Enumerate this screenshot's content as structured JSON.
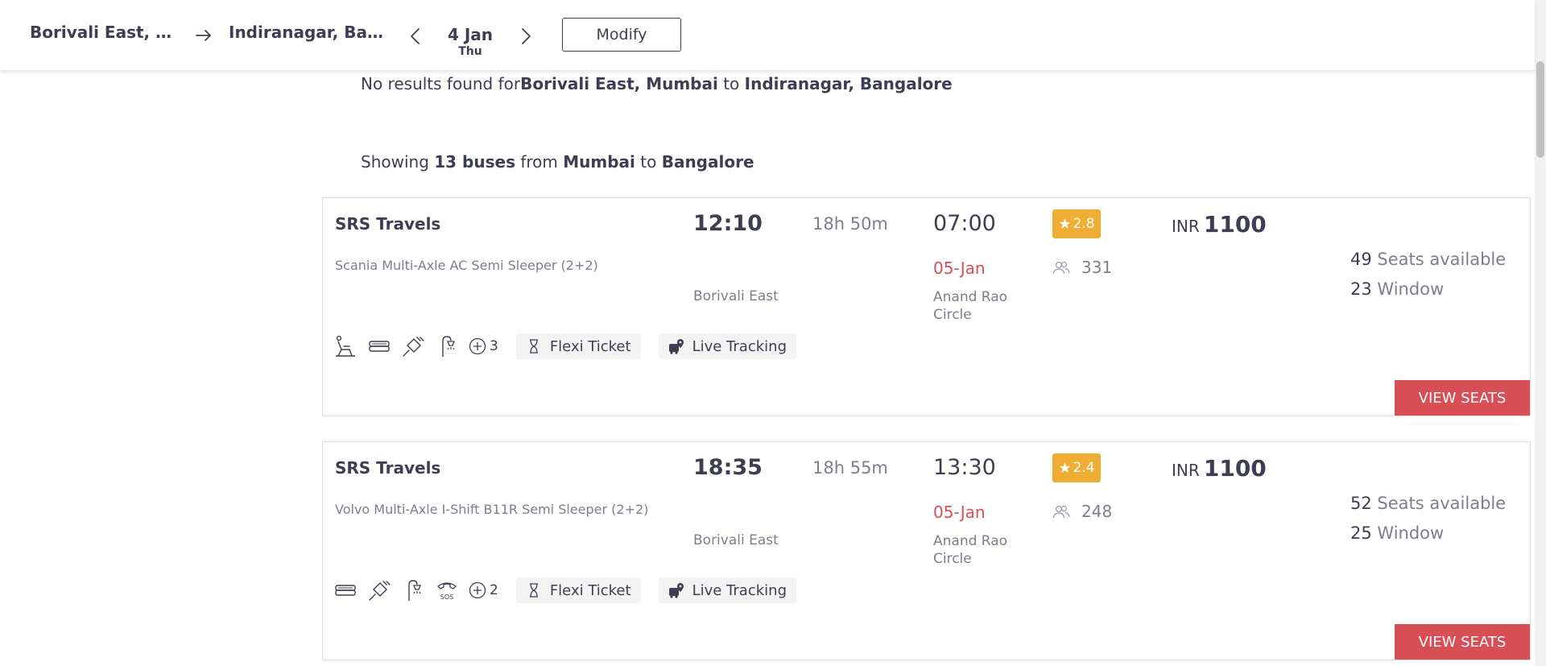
{
  "header": {
    "from": "Borivali East, M...",
    "to": "Indiranagar, Ban...",
    "date": "4 Jan",
    "day": "Thu",
    "modify_label": "Modify"
  },
  "notice": {
    "prefix": "No results found for",
    "from": "Borivali East, Mumbai",
    "joiner": " to ",
    "to": "Indiranagar, Bangalore"
  },
  "showing": {
    "prefix": "Showing ",
    "count": "13 buses",
    "mid": " from ",
    "from": "Mumbai",
    "joiner": " to ",
    "to": "Bangalore"
  },
  "buses": [
    {
      "operator": "SRS Travels",
      "type": "Scania Multi-Axle AC Semi Sleeper (2+2)",
      "departure": "12:10",
      "duration": "18h 50m",
      "arrival": "07:00",
      "arrival_date": "05-Jan",
      "boarding": "Borivali East",
      "dropping": "Anand Rao Circle",
      "rating": "2.8",
      "reviews": "331",
      "currency": "INR",
      "price": "1100",
      "seats_num": "49",
      "seats_label": " Seats available",
      "window_num": "23",
      "window_label": " Window",
      "amenities": [
        "recliner-seat-icon",
        "blanket-icon",
        "charging-point-icon",
        "reading-light-icon"
      ],
      "more_count": "3",
      "tags": [
        "Flexi Ticket",
        "Live Tracking"
      ],
      "button": "VIEW SEATS"
    },
    {
      "operator": "SRS Travels",
      "type": "Volvo Multi-Axle I-Shift B11R Semi Sleeper (2+2)",
      "departure": "18:35",
      "duration": "18h 55m",
      "arrival": "13:30",
      "arrival_date": "05-Jan",
      "boarding": "Borivali East",
      "dropping": "Anand Rao Circle",
      "rating": "2.4",
      "reviews": "248",
      "currency": "INR",
      "price": "1100",
      "seats_num": "52",
      "seats_label": " Seats available",
      "window_num": "25",
      "window_label": " Window",
      "amenities": [
        "blanket-icon",
        "charging-point-icon",
        "reading-light-icon",
        "emergency-contact-icon"
      ],
      "more_count": "2",
      "tags": [
        "Flexi Ticket",
        "Live Tracking"
      ],
      "button": "VIEW SEATS"
    }
  ],
  "colors": {
    "accent": "#d84e55",
    "rating": "#f0ad33",
    "text": "#3e3e52",
    "muted": "#7e7e8c"
  }
}
